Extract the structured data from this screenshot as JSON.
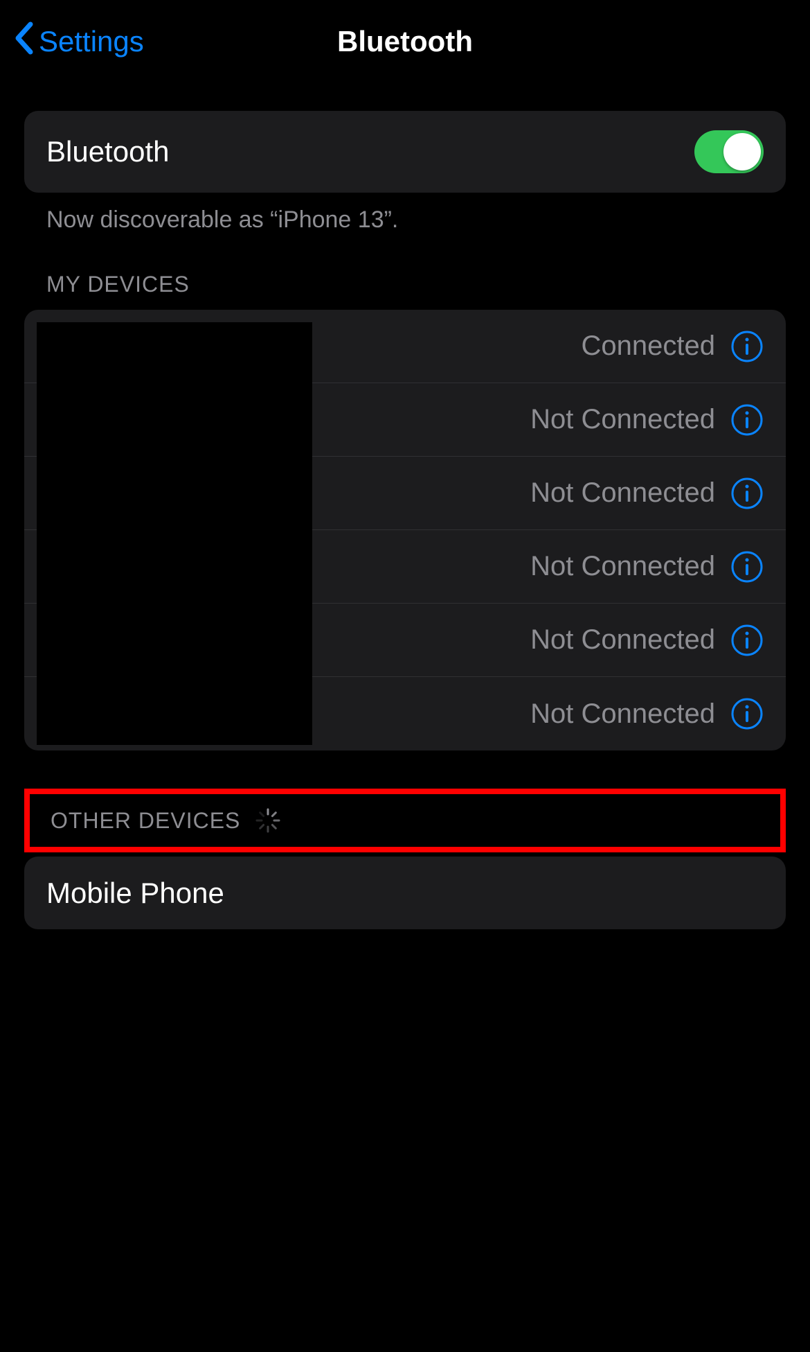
{
  "header": {
    "back_label": "Settings",
    "title": "Bluetooth"
  },
  "main": {
    "bluetooth_label": "Bluetooth",
    "toggle_on": true,
    "discoverable_text": "Now discoverable as “iPhone 13”."
  },
  "sections": {
    "my_devices_header": "MY DEVICES",
    "other_devices_header": "OTHER DEVICES"
  },
  "my_devices": [
    {
      "status": "Connected"
    },
    {
      "status": "Not Connected"
    },
    {
      "status": "Not Connected"
    },
    {
      "status": "Not Connected"
    },
    {
      "status": "Not Connected"
    },
    {
      "status": "Not Connected"
    }
  ],
  "other_devices": [
    {
      "name": "Mobile Phone"
    }
  ],
  "colors": {
    "accent": "#0a84ff",
    "toggle_on": "#34c759",
    "secondary_text": "#8e8e93",
    "card_bg": "#1c1c1e",
    "highlight": "#ff0000"
  }
}
